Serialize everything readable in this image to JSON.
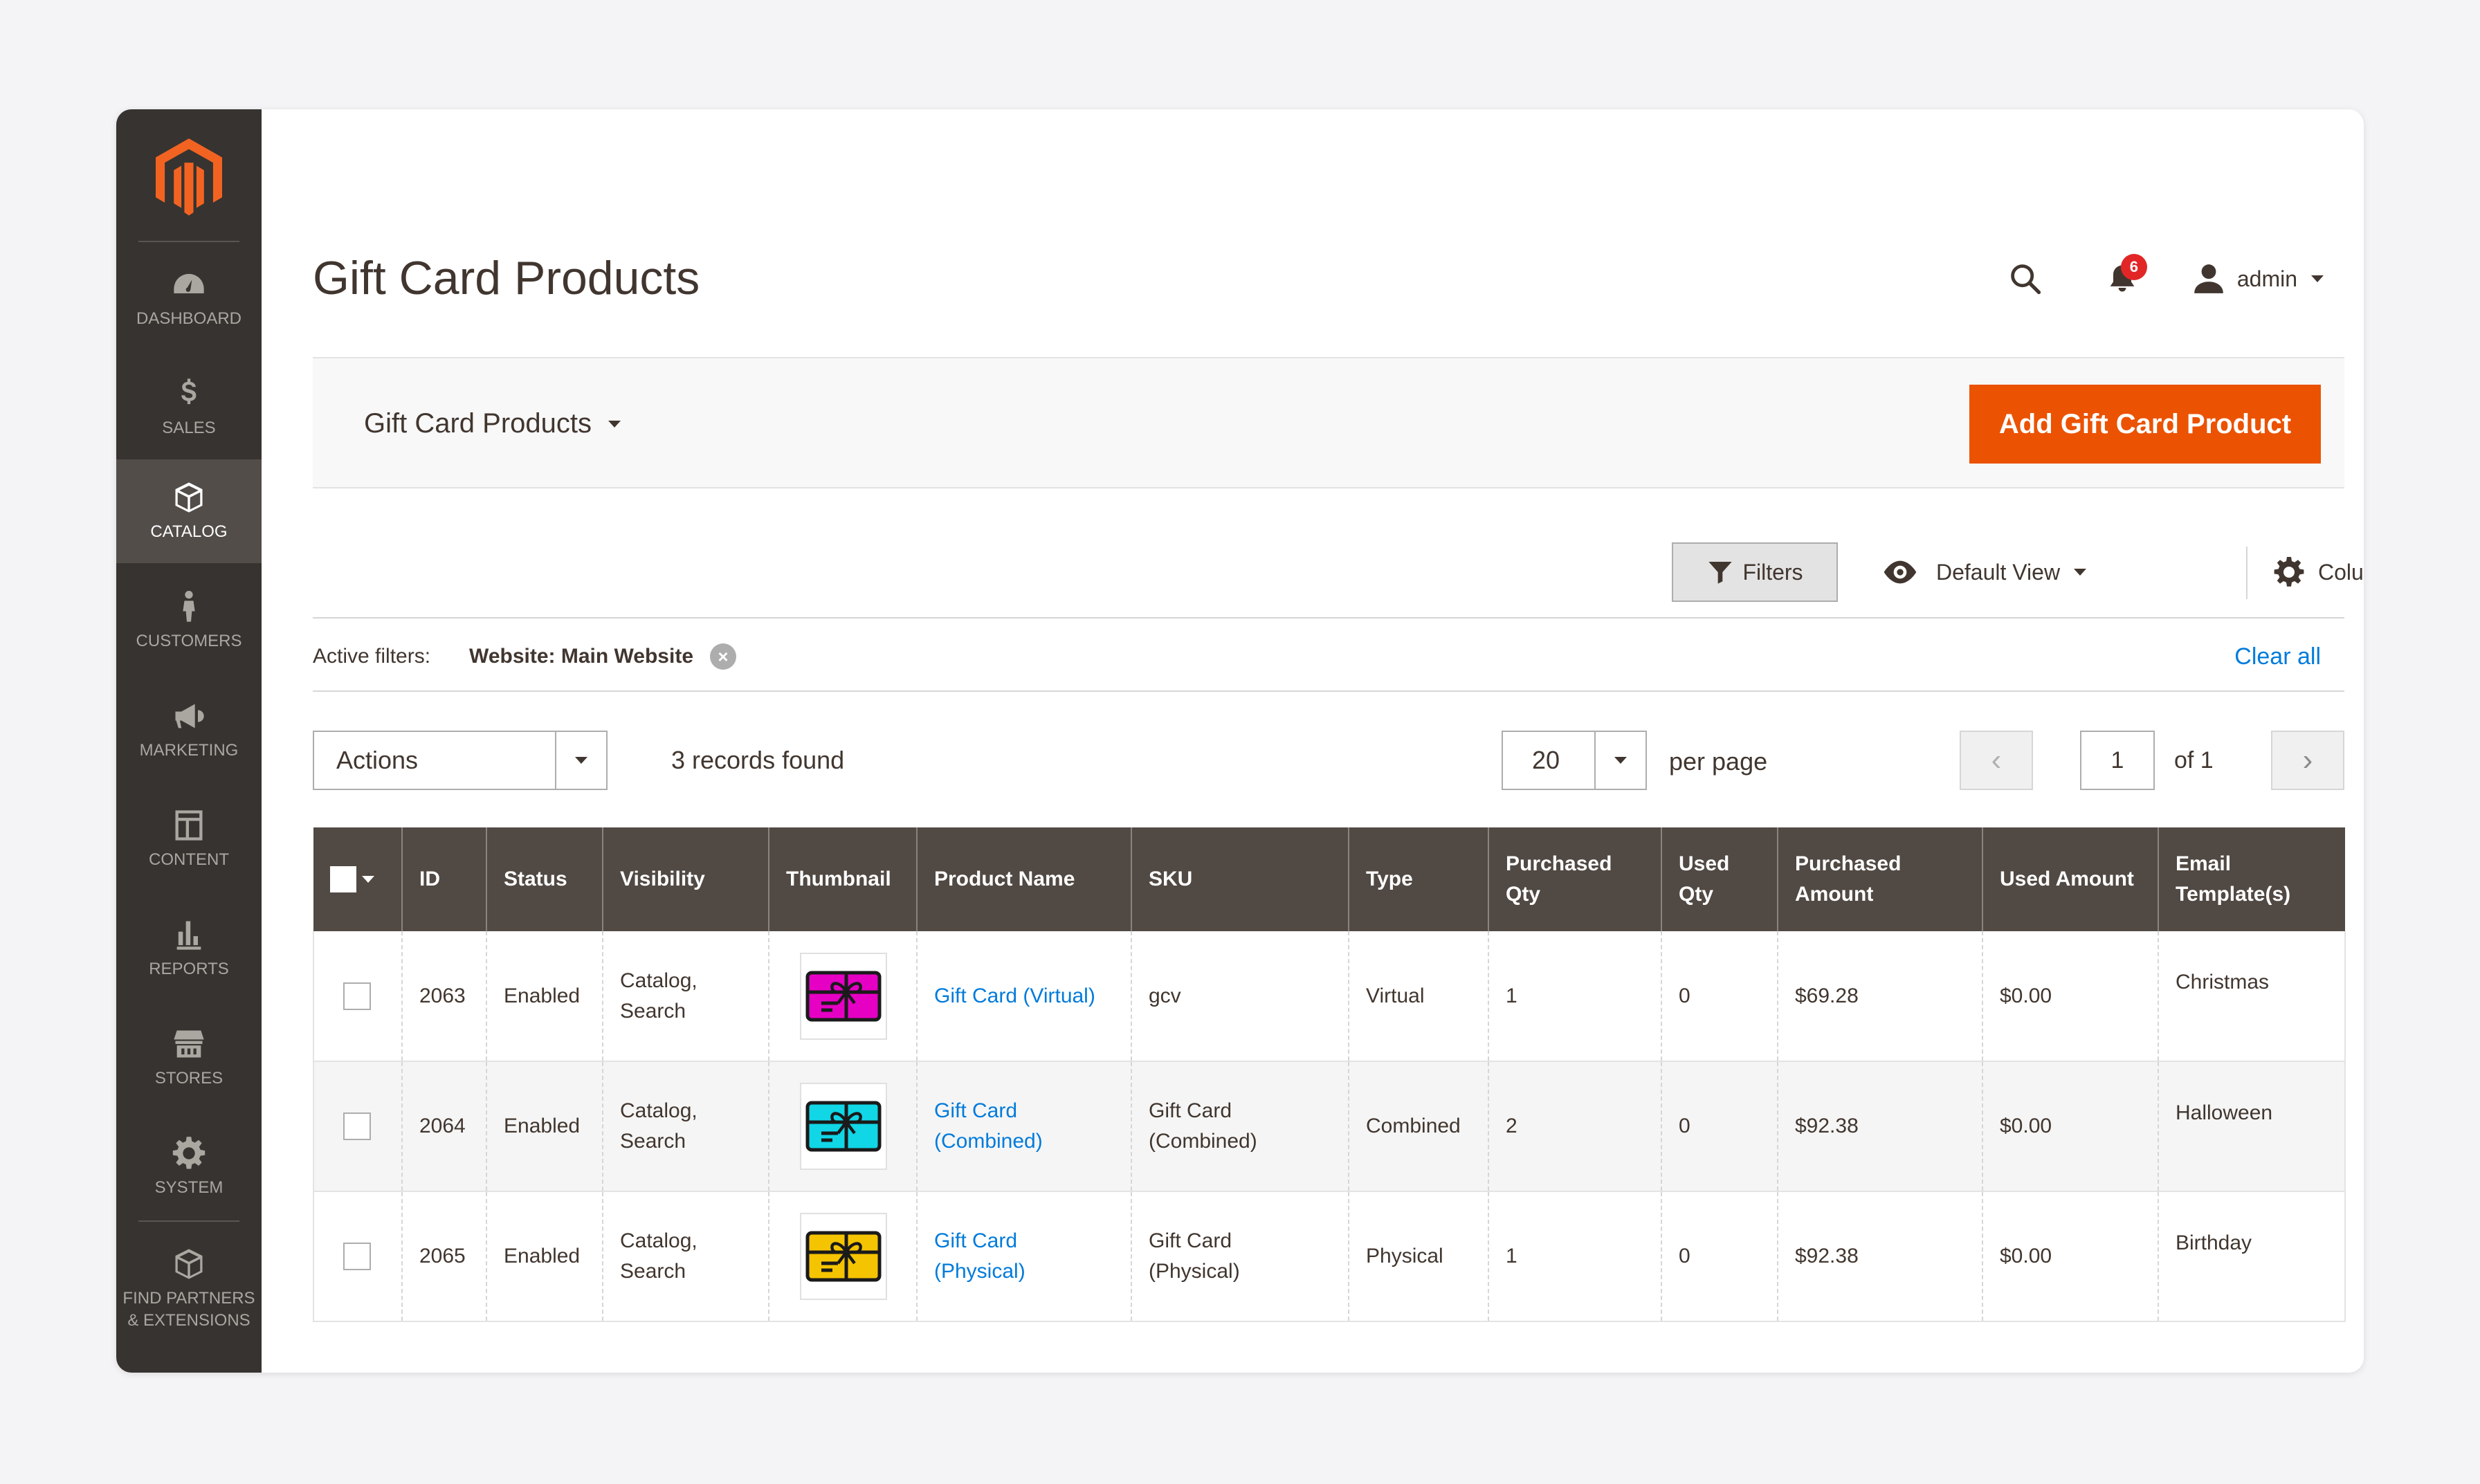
{
  "nav": [
    {
      "label": "DASHBOARD",
      "icon": "dashboard-icon",
      "active": false
    },
    {
      "label": "SALES",
      "icon": "dollar-icon",
      "active": false
    },
    {
      "label": "CATALOG",
      "icon": "cube-icon",
      "active": true
    },
    {
      "label": "CUSTOMERS",
      "icon": "person-icon",
      "active": false
    },
    {
      "label": "MARKETING",
      "icon": "megaphone-icon",
      "active": false
    },
    {
      "label": "CONTENT",
      "icon": "layout-icon",
      "active": false
    },
    {
      "label": "REPORTS",
      "icon": "bar-chart-icon",
      "active": false
    },
    {
      "label": "STORES",
      "icon": "store-icon",
      "active": false
    },
    {
      "label": "SYSTEM",
      "icon": "gear-icon",
      "active": false
    },
    {
      "label": "FIND PARTNERS & EXTENSIONS",
      "icon": "box-icon",
      "active": false
    }
  ],
  "header": {
    "title": "Gift Card Products",
    "notification_count": "6",
    "user": "admin"
  },
  "store_bar": {
    "switcher_label": "Gift Card Products",
    "add_button": "Add Gift Card Product"
  },
  "toolbar": {
    "filters": "Filters",
    "view": "Default View",
    "columns": "Columns"
  },
  "active_filters": {
    "label": "Active filters:",
    "chip": "Website: Main Website",
    "clear_all": "Clear all"
  },
  "grid_controls": {
    "actions": "Actions",
    "records": "3 records found",
    "per_page_value": "20",
    "per_page_label": "per page",
    "page": "1",
    "of_label": "of 1"
  },
  "table": {
    "headers": {
      "id": "ID",
      "status": "Status",
      "visibility": "Visibility",
      "thumbnail": "Thumbnail",
      "name": "Product Name",
      "sku": "SKU",
      "type": "Type",
      "purchased_qty": "Purchased Qty",
      "used_qty": "Used Qty",
      "purchased_amount": "Purchased Amount",
      "used_amount": "Used Amount",
      "email_templates": "Email Template(s)"
    },
    "rows": [
      {
        "id": "2063",
        "status": "Enabled",
        "visibility": "Catalog, Search",
        "card_color": "#e600c4",
        "name": "Gift Card (Virtual)",
        "sku": "gcv",
        "type": "Virtual",
        "purchased_qty": "1",
        "used_qty": "0",
        "purchased_amount": "$69.28",
        "used_amount": "$0.00",
        "email_template": "Christmas"
      },
      {
        "id": "2064",
        "status": "Enabled",
        "visibility": "Catalog, Search",
        "card_color": "#10d6e6",
        "name": "Gift Card (Combined)",
        "sku": "Gift Card (Combined)",
        "type": "Combined",
        "purchased_qty": "2",
        "used_qty": "0",
        "purchased_amount": "$92.38",
        "used_amount": "$0.00",
        "email_template": "Halloween"
      },
      {
        "id": "2065",
        "status": "Enabled",
        "visibility": "Catalog, Search",
        "card_color": "#f5c400",
        "name": "Gift Card (Physical)",
        "sku": "Gift Card (Physical)",
        "type": "Physical",
        "purchased_qty": "1",
        "used_qty": "0",
        "purchased_amount": "$92.38",
        "used_amount": "$0.00",
        "email_template": "Birthday"
      }
    ]
  },
  "colors": {
    "accent": "#eb5202",
    "sidebar": "#373330",
    "table_header": "#514943",
    "link": "#007bdb"
  }
}
